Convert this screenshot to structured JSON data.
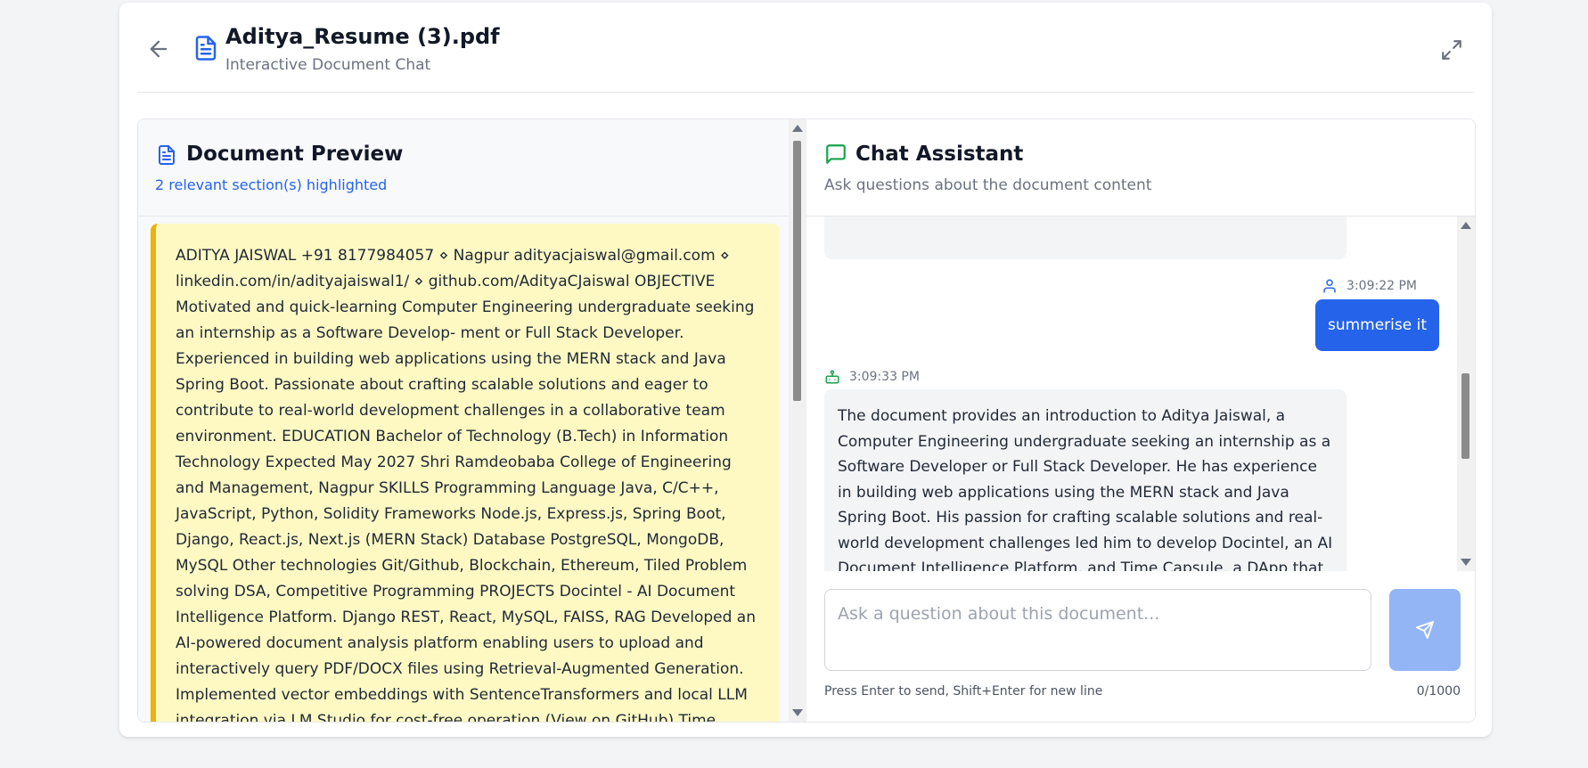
{
  "header": {
    "title": "Aditya_Resume (3).pdf",
    "subtitle": "Interactive Document Chat",
    "back_icon": "arrow-left-icon",
    "doc_icon": "file-text-icon",
    "expand_icon": "maximize-icon"
  },
  "preview": {
    "title": "Document Preview",
    "subtitle": "2 relevant section(s) highlighted",
    "icon": "file-text-icon",
    "highlight_text": "ADITYA JAISWAL +91 8177984057 ⋄ Nagpur adityacjaiswal@gmail.com ⋄ linkedin.com/in/adityajaiswal1/ ⋄ github.com/AdityaCJaiswal OBJECTIVE Motivated and quick-learning Computer Engineering undergraduate seeking an internship as a Software Develop- ment or Full Stack Developer. Experienced in building web applications using the MERN stack and Java Spring Boot. Passionate about crafting scalable solutions and eager to contribute to real-world development challenges in a collaborative team environment. EDUCATION Bachelor of Technology (B.Tech) in Information Technology Expected May 2027 Shri Ramdeobaba College of Engineering and Management, Nagpur SKILLS Programming Language Java, C/C++, JavaScript, Python, Solidity Frameworks Node.js, Express.js, Spring Boot, Django, React.js, Next.js (MERN Stack) Database PostgreSQL, MongoDB, MySQL Other technologies Git/Github, Blockchain, Ethereum, Tiled Problem solving DSA, Competitive Programming PROJECTS Docintel - AI Document Intelligence Platform. Django REST, React, MySQL, FAISS, RAG Developed an AI-powered document analysis platform enabling users to upload and interactively query PDF/DOCX files using Retrieval-Augmented Generation. Implemented vector embeddings with SentenceTransformers and local LLM integration via LM Studio for cost-free operation (View on GitHub) Time Capsule using Blockchain. Solidity, Ethereum, MERN Stack Built a DApp to store time-locked messages on the Ethereum",
    "accent_color": "#eab308",
    "background_color": "#fef9c3"
  },
  "chat": {
    "title": "Chat Assistant",
    "subtitle": "Ask questions about the document content",
    "icon": "message-square-icon",
    "messages": [
      {
        "role": "user",
        "time": "3:09:22 PM",
        "text": "summerise it",
        "icon": "user-icon"
      },
      {
        "role": "assistant",
        "time": "3:09:33 PM",
        "text": "The document provides an introduction to Aditya Jaiswal, a Computer Engineering undergraduate seeking an internship as a Software Developer or Full Stack Developer. He has experience in building web applications using the MERN stack and Java Spring Boot. His passion for crafting scalable solutions and real-world development challenges led him to develop Docintel, an AI Document Intelligence Platform, and Time Capsule, a DApp that stores time-locked messages on the",
        "icon": "bot-icon"
      }
    ],
    "input": {
      "placeholder": "Ask a question about this document...",
      "value": ""
    },
    "send_icon": "send-icon",
    "hint": "Press Enter to send, Shift+Enter for new line",
    "counter": "0/1000",
    "user_bubble_color": "#2563eb",
    "send_button_color": "#93b4f5"
  }
}
